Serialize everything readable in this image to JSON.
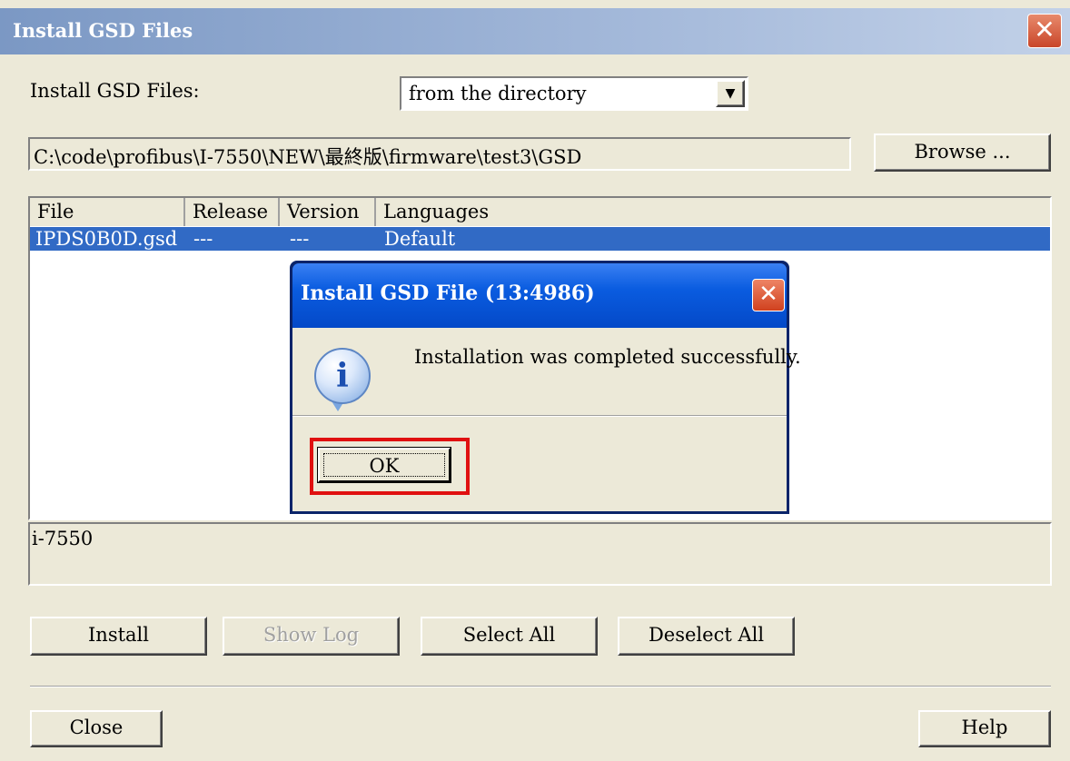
{
  "window": {
    "title": "Install GSD Files",
    "close_glyph": "✕"
  },
  "source": {
    "label": "Install GSD Files:",
    "label_accel": "n",
    "mode_value": "from the directory",
    "dropdown_glyph": "▼"
  },
  "path": {
    "value": "C:\\code\\profibus\\I-7550\\NEW\\最終版\\firmware\\test3\\GSD",
    "browse_label": "Browse ..."
  },
  "listview": {
    "columns": [
      "File",
      "Release",
      "Version",
      "Languages"
    ],
    "rows": [
      {
        "file": "IPDS0B0D.gsd",
        "release": "---",
        "version": "---",
        "languages": "Default",
        "selected": true
      }
    ]
  },
  "description": {
    "text": "i-7550"
  },
  "buttons": {
    "install": "Install",
    "show_log": "Show Log",
    "select_all": "Select All",
    "deselect_all": "Deselect All",
    "close": "Close",
    "help": "Help"
  },
  "dialog": {
    "title": "Install GSD File (13:4986)",
    "message": "Installation was completed successfully.",
    "ok_label": "OK",
    "icon": "info-icon",
    "icon_glyph": "i",
    "close_glyph": "✕",
    "highlight_color": "#e01010"
  },
  "colors": {
    "selection": "#316ac5",
    "face": "#ece9d8",
    "xp_title": "#0a5ce0"
  }
}
